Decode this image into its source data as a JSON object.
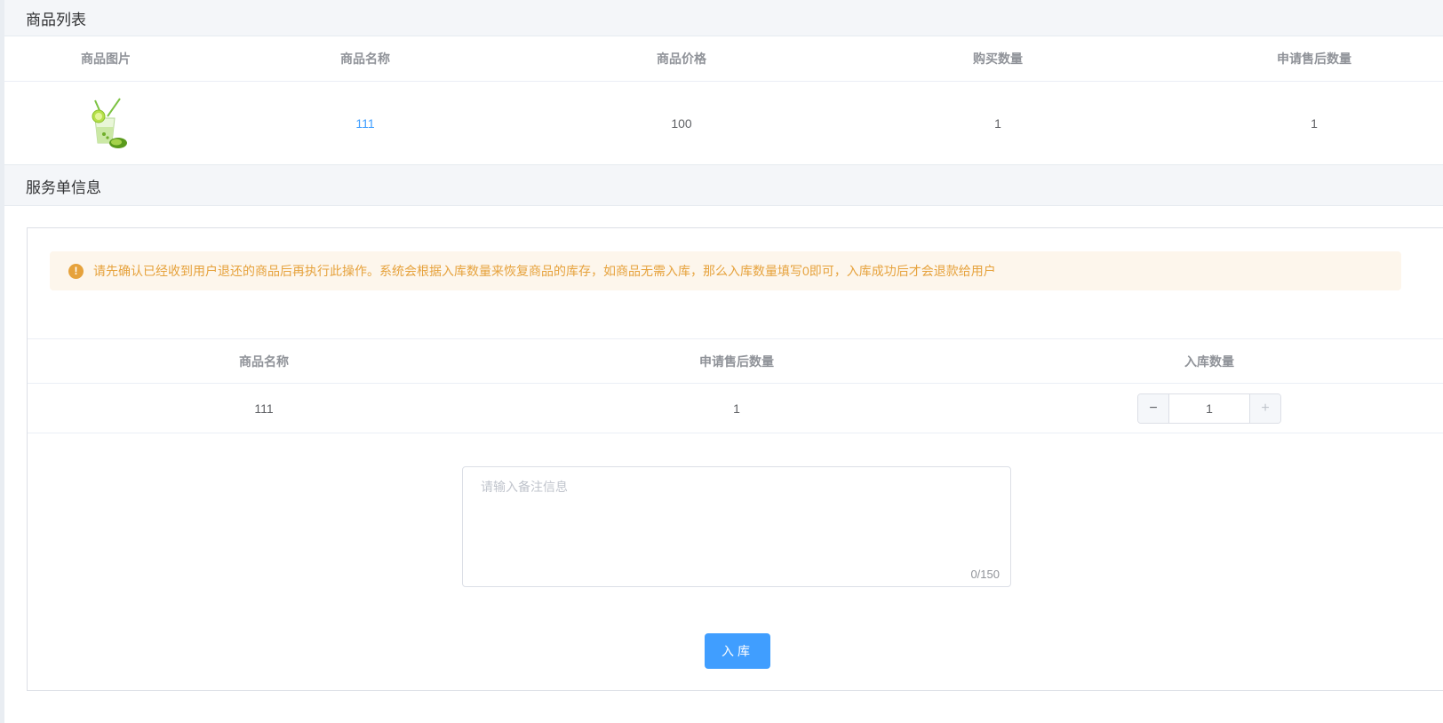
{
  "product_section": {
    "title": "商品列表",
    "columns": [
      "商品图片",
      "商品名称",
      "商品价格",
      "购买数量",
      "申请售后数量"
    ],
    "rows": [
      {
        "image": "lime-cocktail-drink-image",
        "name": "111",
        "price": "100",
        "buy_qty": "1",
        "aftersale_qty": "1"
      }
    ]
  },
  "service_section": {
    "title": "服务单信息",
    "alert": {
      "icon": "warning-icon",
      "icon_glyph": "!",
      "text": "请先确认已经收到用户退还的商品后再执行此操作。系统会根据入库数量来恢复商品的库存，如商品无需入库，那么入库数量填写0即可，入库成功后才会退款给用户"
    },
    "columns": [
      "商品名称",
      "申请售后数量",
      "入库数量"
    ],
    "rows": [
      {
        "name": "111",
        "aftersale_qty": "1",
        "stock_qty": "1"
      }
    ],
    "stepper": {
      "minus_glyph": "−",
      "plus_glyph": "+"
    },
    "remark": {
      "placeholder": "请输入备注信息",
      "counter": "0/150"
    },
    "submit_label": "入库"
  },
  "colors": {
    "primary": "#409eff",
    "warning": "#e6a23c",
    "warning_bg": "#fdf6ec",
    "header_bg": "#f4f6f9"
  }
}
